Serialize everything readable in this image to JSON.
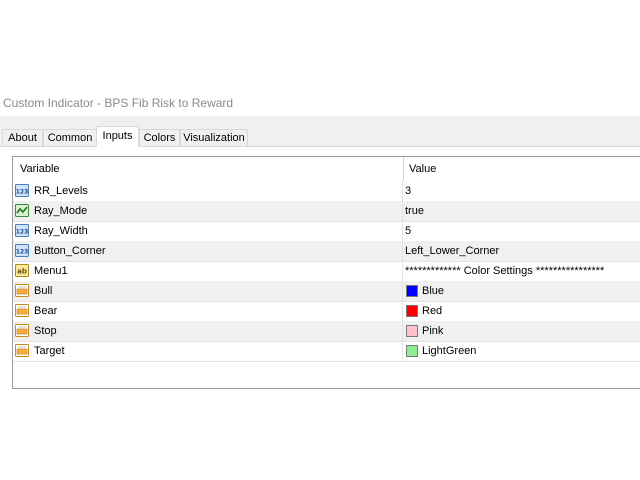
{
  "window": {
    "title": "Custom Indicator - BPS Fib Risk to Reward"
  },
  "tabs": [
    {
      "label": "About",
      "active": false
    },
    {
      "label": "Common",
      "active": false
    },
    {
      "label": "Inputs",
      "active": true
    },
    {
      "label": "Colors",
      "active": false
    },
    {
      "label": "Visualization",
      "active": false
    }
  ],
  "grid": {
    "headers": {
      "variable": "Variable",
      "value": "Value"
    },
    "rows": [
      {
        "variable": "RR_Levels",
        "value": "3",
        "icon": "integer-123-icon"
      },
      {
        "variable": "Ray_Mode",
        "value": "true",
        "icon": "boolean-line-icon"
      },
      {
        "variable": "Ray_Width",
        "value": "5",
        "icon": "integer-123-icon"
      },
      {
        "variable": "Button_Corner",
        "value": "Left_Lower_Corner",
        "icon": "enum-123-icon"
      },
      {
        "variable": "Menu1",
        "value": "************* Color Settings ****************",
        "icon": "string-ab-icon"
      },
      {
        "variable": "Bull",
        "value": "Blue",
        "icon": "color-palette-icon",
        "swatch": "#0000ff"
      },
      {
        "variable": "Bear",
        "value": "Red",
        "icon": "color-palette-icon",
        "swatch": "#ff0000"
      },
      {
        "variable": "Stop",
        "value": "Pink",
        "icon": "color-palette-icon",
        "swatch": "#ffc0cb"
      },
      {
        "variable": "Target",
        "value": "LightGreen",
        "icon": "color-palette-icon",
        "swatch": "#90ee90"
      }
    ]
  },
  "colors": {
    "title_text": "#8a8a8a",
    "row_alt": "#f0f0f0"
  }
}
